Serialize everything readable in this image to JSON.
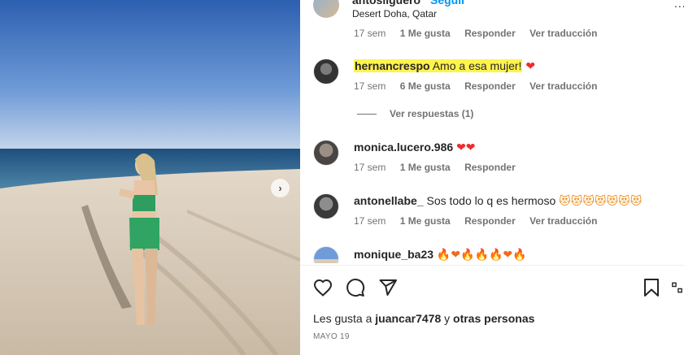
{
  "post": {
    "username": "antosilguero",
    "follow_label": "Seguir",
    "location": "Desert Doha, Qatar",
    "more_glyph": "..."
  },
  "top_meta": {
    "time": "17 sem",
    "likes": "1 Me gusta",
    "reply": "Responder",
    "translate": "Ver traducción"
  },
  "comments": [
    {
      "user": "hernancrespo",
      "text": "Amo a esa mujer!",
      "emoji": "❤",
      "time": "17 sem",
      "likes": "6 Me gusta",
      "reply": "Responder",
      "translate": "Ver traducción",
      "view_replies": "Ver respuestas (1)"
    },
    {
      "user": "monica.lucero.986",
      "text": "",
      "emoji": "❤❤",
      "time": "17 sem",
      "likes": "1 Me gusta",
      "reply": "Responder"
    },
    {
      "user": "antonellabe_",
      "text": "Sos todo lo q es hermoso",
      "emoji": "😻😻😻😻😻😻😻",
      "time": "17 sem",
      "likes": "1 Me gusta",
      "reply": "Responder",
      "translate": "Ver traducción"
    },
    {
      "user": "monique_ba23",
      "text": "",
      "emoji": "🔥❤🔥🔥🔥❤🔥"
    }
  ],
  "actions": {
    "like_icon": "heart-icon",
    "comment_icon": "comment-icon",
    "share_icon": "share-icon",
    "save_icon": "bookmark-icon"
  },
  "likes_summary": {
    "prefix": "Les gusta a",
    "user": "juancar7478",
    "connector": "y",
    "others": "otras personas"
  },
  "date": "MAYO 19",
  "colors": {
    "link_blue": "#0095f6",
    "highlight": "#fff34d",
    "heart_red": "#ed2d2d",
    "secondary_text": "#737373"
  }
}
